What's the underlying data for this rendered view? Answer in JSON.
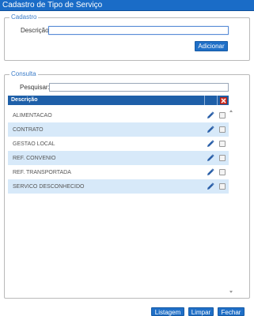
{
  "window": {
    "title": "Cadastro de Tipo de Serviço"
  },
  "cadastro": {
    "legend": "Cadastro",
    "descricao_label": "Descrição:",
    "descricao_value": "",
    "add_button": "Adicionar"
  },
  "consulta": {
    "legend": "Consulta",
    "pesquisar_label": "Pesquisar:",
    "pesquisar_value": "",
    "column_header": "Descrição",
    "rows": [
      {
        "descricao": "ALIMENTACAO"
      },
      {
        "descricao": "CONTRATO"
      },
      {
        "descricao": "GESTAO LOCAL"
      },
      {
        "descricao": "REF. CONVENIO"
      },
      {
        "descricao": "REF. TRANSPORTADA"
      },
      {
        "descricao": "SERVICO DESCONHECIDO"
      }
    ]
  },
  "footer": {
    "listagem": "Listagem",
    "limpar": "Limpar",
    "fechar": "Fechar"
  },
  "icons": {
    "edit": "pencil-icon",
    "delete_all": "close-x-icon"
  },
  "colors": {
    "accent": "#1f6fc7",
    "header": "#1e5fa8",
    "row_alt": "#d7e9f9",
    "delete": "#d93a2e"
  }
}
